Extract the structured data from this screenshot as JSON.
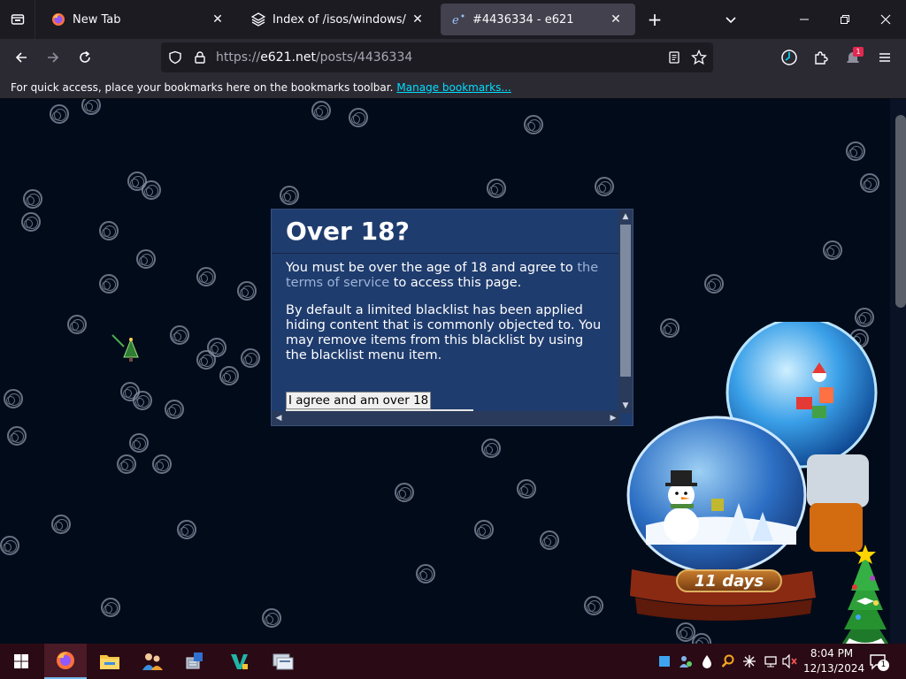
{
  "browser": {
    "tabs": [
      {
        "title": "New Tab",
        "icon": "firefox-icon",
        "active": false
      },
      {
        "title": "Index of /isos/windows/",
        "icon": "folder-stack-icon",
        "active": false
      },
      {
        "title": "#4436334 - e621",
        "icon": "e621-icon",
        "active": true
      }
    ],
    "newtab_label": "+",
    "url": {
      "scheme": "https://",
      "host": "e621.net",
      "path": "/posts/4436334"
    },
    "bookmarks_text": "For quick access, place your bookmarks here on the bookmarks toolbar.",
    "bookmarks_link": "Manage bookmarks...",
    "extension_badge": "1"
  },
  "modal": {
    "title": "Over 18?",
    "p1_before": "You must be over the age of 18 and agree to ",
    "p1_link": "the terms of service",
    "p1_after": " to access this page.",
    "p2": "By default a limited blacklist has been applied hiding content that is commonly objected to. You may remove items from this blacklist by using the blacklist menu item.",
    "agree_label": "I agree and am over 18"
  },
  "gadget": {
    "countdown": "11 days"
  },
  "taskbar": {
    "apps": [
      "firefox-icon",
      "file-explorer-icon",
      "people-icon",
      "installer-icon",
      "vscode-icon",
      "network-icon"
    ],
    "time": "8:04 PM",
    "date": "12/13/2024",
    "notification_count": "1"
  },
  "colors": {
    "page_bg": "#020b1a",
    "modal_bg": "#1f3c6e",
    "link": "#00ddff",
    "taskbar_bg": "#2a0a14"
  }
}
